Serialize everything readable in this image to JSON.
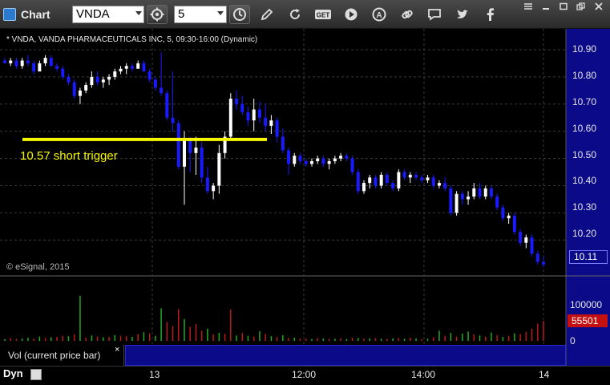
{
  "toolbar": {
    "app_title": "Chart",
    "symbol": "VNDA",
    "interval": "5",
    "icons": [
      "settings-icon",
      "clock-icon",
      "pencil-icon",
      "refresh-icon",
      "get-icon",
      "play-icon",
      "alert-icon",
      "link-icon",
      "comment-icon",
      "twitter-icon",
      "facebook-icon"
    ],
    "get_label": "GET"
  },
  "chart": {
    "caption": "* VNDA, VANDA PHARMACEUTICALS INC, 5, 09:30-16:00 (Dynamic)",
    "copyright": "© eSignal, 2015",
    "annotation": "10.57 short trigger",
    "trigger_color": "#f6f600",
    "up_color": "#ffffff",
    "down_color": "#1a1aff",
    "y_ticks": [
      "10.90",
      "10.80",
      "10.70",
      "10.60",
      "10.50",
      "10.40",
      "10.30",
      "10.20"
    ],
    "last_price": "10.11",
    "x_labels": [
      "13",
      "12:00",
      "14:00",
      "14"
    ]
  },
  "volume": {
    "label": "Vol (current price bar)",
    "close_glyph": "×",
    "ticks": [
      "100000",
      "0"
    ],
    "last_volume": "55501",
    "up_color": "#22aa22",
    "down_color": "#bb1a1a"
  },
  "bottom": {
    "mode": "Dyn"
  },
  "chart_data": {
    "type": "candlestick",
    "trigger_level": 10.57,
    "ylim": [
      10.08,
      10.95
    ],
    "candles": [
      [
        10.86,
        10.87,
        10.85,
        10.85
      ],
      [
        10.85,
        10.87,
        10.84,
        10.86
      ],
      [
        10.86,
        10.87,
        10.83,
        10.84
      ],
      [
        10.84,
        10.87,
        10.83,
        10.86
      ],
      [
        10.86,
        10.88,
        10.84,
        10.85
      ],
      [
        10.85,
        10.86,
        10.81,
        10.82
      ],
      [
        10.82,
        10.86,
        10.82,
        10.85
      ],
      [
        10.85,
        10.88,
        10.84,
        10.87
      ],
      [
        10.87,
        10.88,
        10.84,
        10.84
      ],
      [
        10.84,
        10.85,
        10.82,
        10.83
      ],
      [
        10.83,
        10.84,
        10.79,
        10.8
      ],
      [
        10.8,
        10.81,
        10.77,
        10.78
      ],
      [
        10.78,
        10.79,
        10.72,
        10.73
      ],
      [
        10.73,
        10.76,
        10.7,
        10.75
      ],
      [
        10.75,
        10.78,
        10.74,
        10.77
      ],
      [
        10.77,
        10.82,
        10.76,
        10.8
      ],
      [
        10.8,
        10.82,
        10.77,
        10.78
      ],
      [
        10.78,
        10.8,
        10.76,
        10.79
      ],
      [
        10.79,
        10.81,
        10.77,
        10.8
      ],
      [
        10.8,
        10.83,
        10.79,
        10.82
      ],
      [
        10.82,
        10.84,
        10.81,
        10.83
      ],
      [
        10.83,
        10.85,
        10.81,
        10.84
      ],
      [
        10.84,
        10.85,
        10.82,
        10.83
      ],
      [
        10.83,
        10.86,
        10.83,
        10.85
      ],
      [
        10.85,
        10.86,
        10.82,
        10.82
      ],
      [
        10.82,
        10.83,
        10.78,
        10.79
      ],
      [
        10.79,
        10.8,
        10.75,
        10.76
      ],
      [
        10.76,
        10.89,
        10.73,
        10.74
      ],
      [
        10.74,
        10.75,
        10.64,
        10.65
      ],
      [
        10.65,
        10.82,
        10.6,
        10.63
      ],
      [
        10.63,
        10.64,
        10.46,
        10.47
      ],
      [
        10.47,
        10.6,
        10.33,
        10.57
      ],
      [
        10.57,
        10.58,
        10.45,
        10.52
      ],
      [
        10.52,
        10.58,
        10.44,
        10.54
      ],
      [
        10.54,
        10.56,
        10.41,
        10.43
      ],
      [
        10.43,
        10.47,
        10.37,
        10.38
      ],
      [
        10.38,
        10.41,
        10.35,
        10.4
      ],
      [
        10.4,
        10.55,
        10.37,
        10.52
      ],
      [
        10.52,
        10.6,
        10.5,
        10.58
      ],
      [
        10.58,
        10.74,
        10.57,
        10.72
      ],
      [
        10.72,
        10.75,
        10.68,
        10.7
      ],
      [
        10.7,
        10.73,
        10.66,
        10.67
      ],
      [
        10.67,
        10.69,
        10.62,
        10.64
      ],
      [
        10.64,
        10.72,
        10.6,
        10.68
      ],
      [
        10.68,
        10.71,
        10.63,
        10.65
      ],
      [
        10.65,
        10.7,
        10.6,
        10.62
      ],
      [
        10.62,
        10.66,
        10.59,
        10.64
      ],
      [
        10.64,
        10.65,
        10.56,
        10.58
      ],
      [
        10.58,
        10.61,
        10.52,
        10.53
      ],
      [
        10.53,
        10.54,
        10.44,
        10.48
      ],
      [
        10.48,
        10.52,
        10.47,
        10.51
      ],
      [
        10.51,
        10.52,
        10.48,
        10.49
      ],
      [
        10.49,
        10.5,
        10.47,
        10.48
      ],
      [
        10.48,
        10.5,
        10.47,
        10.49
      ],
      [
        10.49,
        10.51,
        10.48,
        10.5
      ],
      [
        10.5,
        10.51,
        10.47,
        10.48
      ],
      [
        10.48,
        10.5,
        10.46,
        10.49
      ],
      [
        10.49,
        10.51,
        10.48,
        10.5
      ],
      [
        10.5,
        10.52,
        10.49,
        10.51
      ],
      [
        10.51,
        10.52,
        10.49,
        10.5
      ],
      [
        10.5,
        10.51,
        10.44,
        10.45
      ],
      [
        10.45,
        10.46,
        10.37,
        10.38
      ],
      [
        10.38,
        10.42,
        10.37,
        10.41
      ],
      [
        10.41,
        10.44,
        10.39,
        10.43
      ],
      [
        10.43,
        10.44,
        10.39,
        10.4
      ],
      [
        10.4,
        10.45,
        10.39,
        10.44
      ],
      [
        10.44,
        10.45,
        10.4,
        10.41
      ],
      [
        10.41,
        10.42,
        10.38,
        10.39
      ],
      [
        10.39,
        10.46,
        10.38,
        10.45
      ],
      [
        10.45,
        10.46,
        10.42,
        10.43
      ],
      [
        10.43,
        10.45,
        10.41,
        10.44
      ],
      [
        10.44,
        10.45,
        10.42,
        10.43
      ],
      [
        10.43,
        10.44,
        10.41,
        10.42
      ],
      [
        10.42,
        10.44,
        10.41,
        10.43
      ],
      [
        10.43,
        10.44,
        10.39,
        10.4
      ],
      [
        10.4,
        10.42,
        10.39,
        10.41
      ],
      [
        10.41,
        10.43,
        10.38,
        10.39
      ],
      [
        10.39,
        10.4,
        10.29,
        10.3
      ],
      [
        10.3,
        10.38,
        10.29,
        10.37
      ],
      [
        10.37,
        10.38,
        10.33,
        10.35
      ],
      [
        10.35,
        10.38,
        10.33,
        10.36
      ],
      [
        10.36,
        10.41,
        10.35,
        10.39
      ],
      [
        10.39,
        10.41,
        10.35,
        10.36
      ],
      [
        10.36,
        10.4,
        10.35,
        10.39
      ],
      [
        10.39,
        10.4,
        10.35,
        10.36
      ],
      [
        10.36,
        10.37,
        10.31,
        10.32
      ],
      [
        10.32,
        10.33,
        10.27,
        10.28
      ],
      [
        10.28,
        10.3,
        10.26,
        10.29
      ],
      [
        10.29,
        10.3,
        10.22,
        10.23
      ],
      [
        10.23,
        10.24,
        10.18,
        10.19
      ],
      [
        10.19,
        10.22,
        10.17,
        10.21
      ],
      [
        10.21,
        10.22,
        10.14,
        10.15
      ],
      [
        10.15,
        10.16,
        10.11,
        10.12
      ],
      [
        10.12,
        10.14,
        10.1,
        10.11
      ]
    ],
    "volumes": [
      [
        5000,
        1
      ],
      [
        8000,
        0
      ],
      [
        6000,
        0
      ],
      [
        7000,
        1
      ],
      [
        9000,
        1
      ],
      [
        6000,
        0
      ],
      [
        12000,
        1
      ],
      [
        8000,
        0
      ],
      [
        10000,
        1
      ],
      [
        11000,
        0
      ],
      [
        14000,
        0
      ],
      [
        13000,
        1
      ],
      [
        18000,
        0
      ],
      [
        125000,
        1
      ],
      [
        9000,
        0
      ],
      [
        15000,
        1
      ],
      [
        12000,
        0
      ],
      [
        10000,
        1
      ],
      [
        11000,
        0
      ],
      [
        16000,
        1
      ],
      [
        14000,
        0
      ],
      [
        13000,
        0
      ],
      [
        11000,
        1
      ],
      [
        19000,
        0
      ],
      [
        24000,
        1
      ],
      [
        21000,
        0
      ],
      [
        14000,
        1
      ],
      [
        90000,
        1
      ],
      [
        52000,
        0
      ],
      [
        41000,
        0
      ],
      [
        88000,
        0
      ],
      [
        60000,
        1
      ],
      [
        39000,
        0
      ],
      [
        47000,
        0
      ],
      [
        28000,
        0
      ],
      [
        34000,
        1
      ],
      [
        18000,
        0
      ],
      [
        22000,
        1
      ],
      [
        20000,
        0
      ],
      [
        87000,
        0
      ],
      [
        15000,
        1
      ],
      [
        22000,
        0
      ],
      [
        14000,
        1
      ],
      [
        12000,
        0
      ],
      [
        27000,
        1
      ],
      [
        19000,
        0
      ],
      [
        13000,
        1
      ],
      [
        11000,
        0
      ],
      [
        16000,
        1
      ],
      [
        8000,
        0
      ],
      [
        9000,
        1
      ],
      [
        7000,
        0
      ],
      [
        6000,
        0
      ],
      [
        5000,
        1
      ],
      [
        8000,
        0
      ],
      [
        7000,
        1
      ],
      [
        5000,
        0
      ],
      [
        6000,
        1
      ],
      [
        7000,
        0
      ],
      [
        5000,
        1
      ],
      [
        9000,
        0
      ],
      [
        8000,
        1
      ],
      [
        6000,
        0
      ],
      [
        7000,
        1
      ],
      [
        8000,
        0
      ],
      [
        6000,
        1
      ],
      [
        5000,
        0
      ],
      [
        7000,
        1
      ],
      [
        8000,
        0
      ],
      [
        6000,
        1
      ],
      [
        9000,
        0
      ],
      [
        7000,
        1
      ],
      [
        5000,
        0
      ],
      [
        6000,
        1
      ],
      [
        10000,
        0
      ],
      [
        28000,
        1
      ],
      [
        14000,
        0
      ],
      [
        22000,
        1
      ],
      [
        12000,
        0
      ],
      [
        20000,
        1
      ],
      [
        26000,
        1
      ],
      [
        18000,
        0
      ],
      [
        15000,
        1
      ],
      [
        12000,
        0
      ],
      [
        23000,
        1
      ],
      [
        16000,
        0
      ],
      [
        11000,
        1
      ],
      [
        14000,
        0
      ],
      [
        21000,
        1
      ],
      [
        19000,
        0
      ],
      [
        25000,
        0
      ],
      [
        34000,
        0
      ],
      [
        48000,
        0
      ],
      [
        55501,
        0
      ]
    ],
    "volume_max": 120000
  }
}
